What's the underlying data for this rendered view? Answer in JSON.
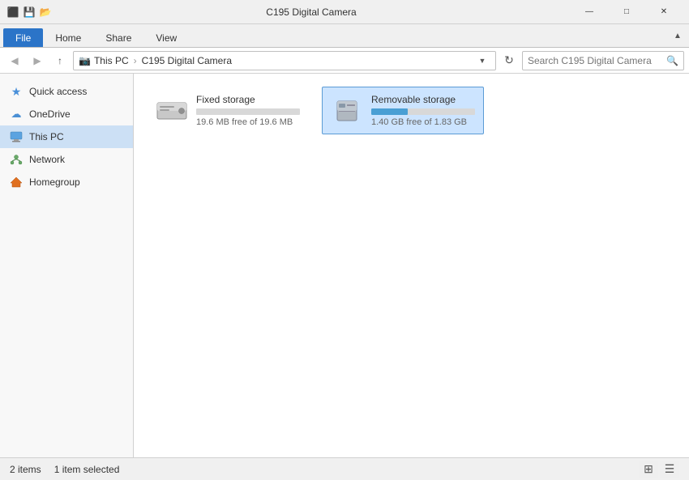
{
  "window": {
    "title": "C195 Digital Camera",
    "icon": "📷"
  },
  "titlebar": {
    "system_icons": [
      "⬛",
      "💾",
      "📂"
    ],
    "minimize": "—",
    "maximize": "□",
    "close": "✕"
  },
  "ribbon": {
    "tabs": [
      {
        "id": "file",
        "label": "File",
        "active": true
      },
      {
        "id": "home",
        "label": "Home",
        "active": false
      },
      {
        "id": "share",
        "label": "Share",
        "active": false
      },
      {
        "id": "view",
        "label": "View",
        "active": false
      }
    ],
    "expand_label": "▲"
  },
  "addressbar": {
    "back_label": "◀",
    "forward_label": "▶",
    "up_label": "↑",
    "path_icon": "📷",
    "breadcrumb": [
      {
        "label": "This PC",
        "id": "this-pc"
      },
      {
        "label": "C195 Digital Camera",
        "id": "camera"
      }
    ],
    "refresh_label": "↻",
    "search_placeholder": "Search C195 Digital Camera",
    "search_icon": "🔍"
  },
  "sidebar": {
    "items": [
      {
        "id": "quick-access",
        "label": "Quick access",
        "icon": "★",
        "type": "quick-access"
      },
      {
        "id": "onedrive",
        "label": "OneDrive",
        "icon": "☁",
        "type": "onedrive"
      },
      {
        "id": "this-pc",
        "label": "This PC",
        "icon": "💻",
        "type": "thispc",
        "selected": true
      },
      {
        "id": "network",
        "label": "Network",
        "icon": "🌐",
        "type": "network"
      },
      {
        "id": "homegroup",
        "label": "Homegroup",
        "icon": "🏠",
        "type": "homegroup"
      }
    ]
  },
  "content": {
    "items": [
      {
        "id": "fixed-storage",
        "name": "Fixed storage",
        "size_label": "19.6 MB free of 19.6 MB",
        "fill_pct": 0,
        "fill_color": "#a0a0a0",
        "selected": false
      },
      {
        "id": "removable-storage",
        "name": "Removable storage",
        "size_label": "1.40 GB free of 1.83 GB",
        "fill_pct": 35,
        "fill_color": "#4a9fd4",
        "selected": true
      }
    ]
  },
  "statusbar": {
    "items_count": "2 items",
    "selected_count": "1 item selected",
    "view_icons": [
      "⊞",
      "☰"
    ]
  }
}
